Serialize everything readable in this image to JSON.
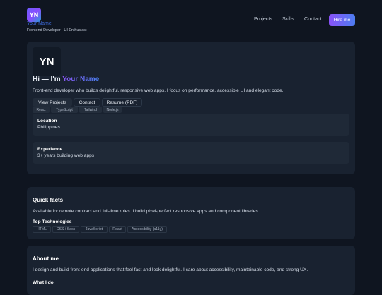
{
  "header": {
    "logo_initials": "YN",
    "brand_name": "Your Name",
    "tagline": "Frontend Developer · UI Enthusiast",
    "nav": [
      "Projects",
      "Skills",
      "Contact"
    ],
    "hire_label": "Hire me"
  },
  "hero": {
    "avatar_initials": "YN",
    "title_prefix": "Hi — I'm ",
    "title_name": "Your Name",
    "intro": "Front-end developer who builds delightful, responsive web apps. I focus on performance, accessible UI and elegant code.",
    "buttons": [
      "View Projects",
      "Contact",
      "Resume (PDF)"
    ],
    "chips": [
      "React",
      "TypeScript",
      "Tailwind",
      "Node.js"
    ],
    "location_label": "Location",
    "location_value": "Philippines",
    "experience_label": "Experience",
    "experience_value": "3+ years building web apps"
  },
  "quick_facts": {
    "title": "Quick facts",
    "text": "Available for remote contract and full-time roles. I build pixel-perfect responsive apps and component libraries.",
    "tech_title": "Top Technologies",
    "tech": [
      "HTML",
      "CSS / Sass",
      "JavaScript",
      "React",
      "Accessibility (a11y)"
    ]
  },
  "about": {
    "title": "About me",
    "text": "I design and build front-end applications that feel fast and look delightful. I care about accessibility, maintainable code, and strong UX.",
    "what_title": "What I do"
  }
}
